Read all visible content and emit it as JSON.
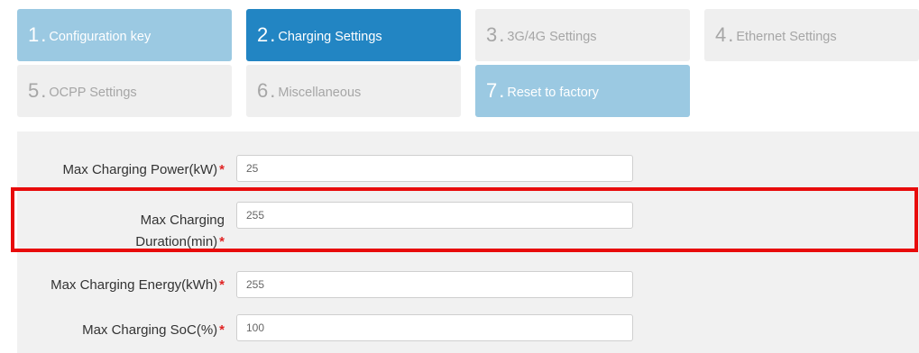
{
  "tabs": [
    {
      "num": "1",
      "label": "Configuration key"
    },
    {
      "num": "2",
      "label": "Charging Settings"
    },
    {
      "num": "3",
      "label": "3G/4G Settings"
    },
    {
      "num": "4",
      "label": "Ethernet Settings"
    },
    {
      "num": "5",
      "label": "OCPP Settings"
    },
    {
      "num": "6",
      "label": "Miscellaneous"
    },
    {
      "num": "7",
      "label": "Reset to factory"
    }
  ],
  "active_tab": "2",
  "form": {
    "required_marker": "*",
    "fields": [
      {
        "label": "Max Charging Power(kW)",
        "value": "25"
      },
      {
        "label_line1": "Max Charging",
        "label_line2": "Duration(min)",
        "value": "255"
      },
      {
        "label": "Max Charging Energy(kWh)",
        "value": "255"
      },
      {
        "label": "Max Charging SoC(%)",
        "value": "100"
      }
    ]
  },
  "colors": {
    "tab_active": "#2285c3",
    "tab_light": "#9bc9e2",
    "tab_grey": "#efefef",
    "panel_bg": "#f1f1f1",
    "required": "#e02424",
    "highlight": "#e80b0b"
  }
}
